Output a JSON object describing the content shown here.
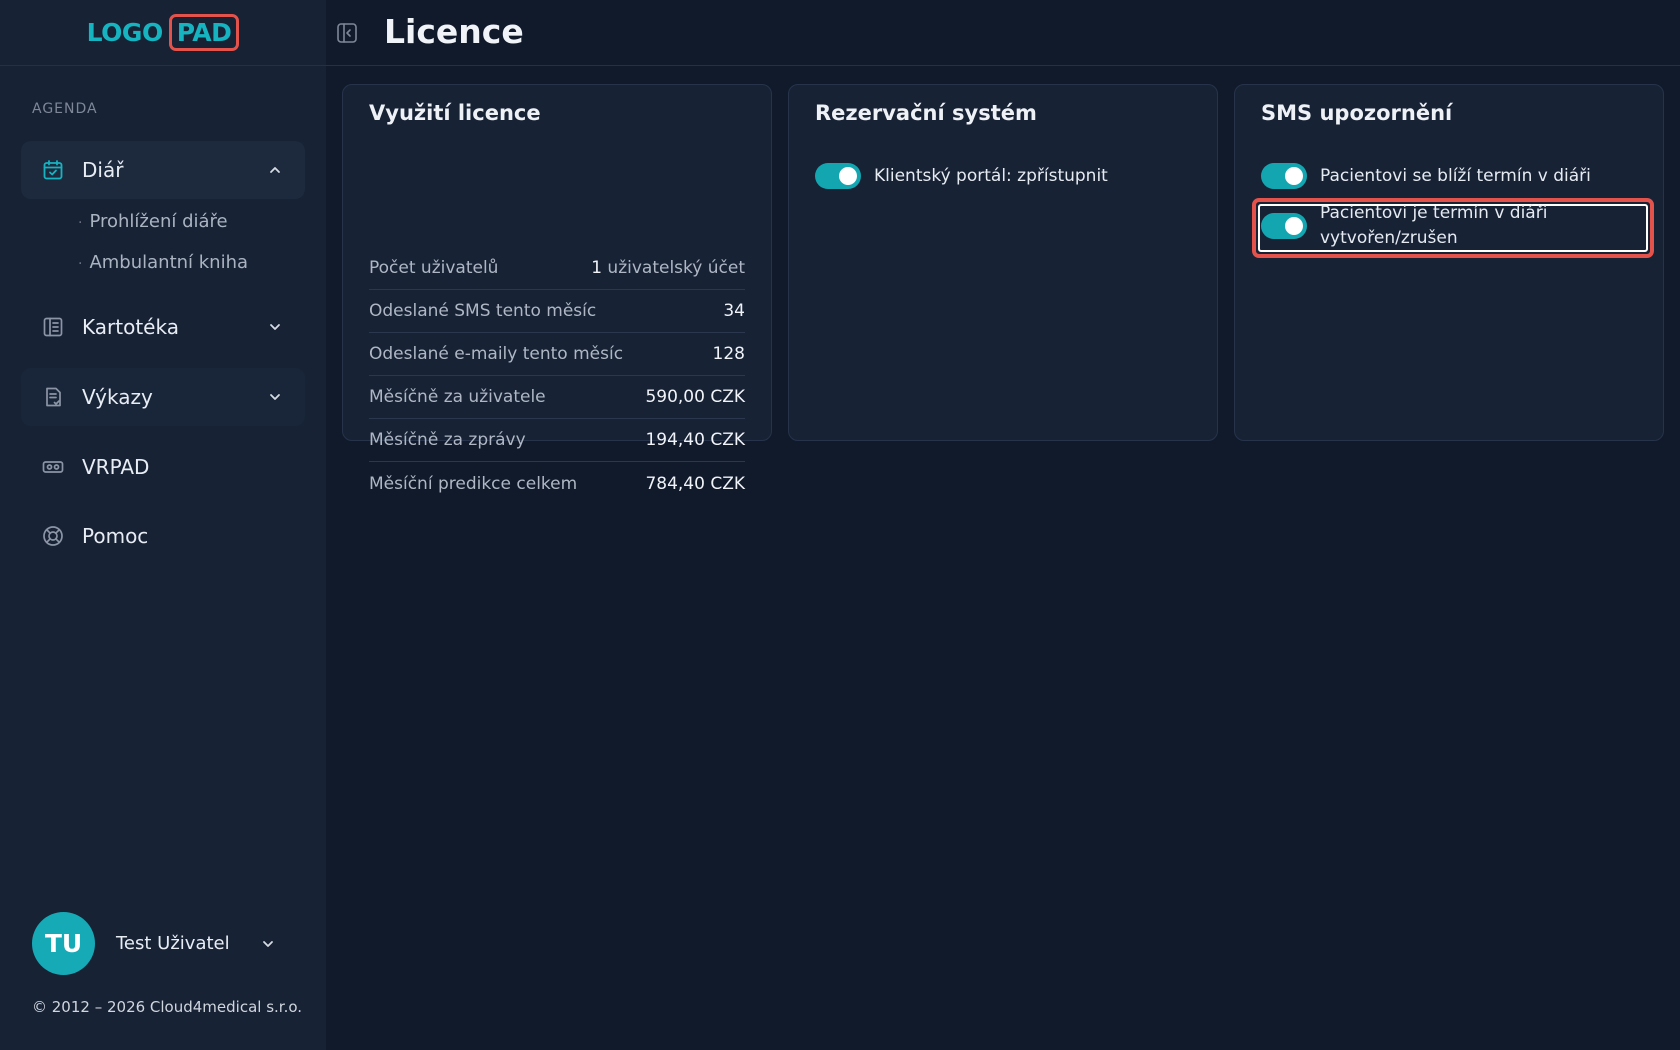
{
  "logo": {
    "left": "LOGO",
    "right": "PAD"
  },
  "sidebar": {
    "section_label": "AGENDA",
    "items": [
      {
        "label": "Diář",
        "icon": "calendar-check-icon"
      },
      {
        "label": "Kartotéka",
        "icon": "book-icon"
      },
      {
        "label": "Výkazy",
        "icon": "document-icon"
      },
      {
        "label": "VRPAD",
        "icon": "vr-headset-icon"
      },
      {
        "label": "Pomoc",
        "icon": "lifebuoy-icon"
      }
    ],
    "sub_items": [
      "Prohlížení diáře",
      "Ambulantní kniha"
    ]
  },
  "user": {
    "initials": "TU",
    "name": "Test Uživatel"
  },
  "copyright": "© 2012 – 2026 Cloud4medical s.r.o.",
  "header": {
    "title": "Licence"
  },
  "license_card": {
    "title": "Využití licence",
    "rows": [
      {
        "label": "Počet uživatelů",
        "value": "1",
        "unit": " uživatelský účet"
      },
      {
        "label": "Odeslané SMS tento měsíc",
        "value": "34",
        "unit": ""
      },
      {
        "label": "Odeslané e-maily tento měsíc",
        "value": "128",
        "unit": ""
      },
      {
        "label": "Měsíčně za uživatele",
        "value": "590,00 CZK",
        "unit": ""
      },
      {
        "label": "Měsíčně za zprávy",
        "value": "194,40 CZK",
        "unit": ""
      },
      {
        "label": "Měsíční predikce celkem",
        "value": "784,40 CZK",
        "unit": ""
      }
    ]
  },
  "reservation_card": {
    "title": "Rezervační systém",
    "toggles": [
      {
        "label": "Klientský portál: zpřístupnit",
        "on": true
      }
    ]
  },
  "sms_card": {
    "title": "SMS upozornění",
    "toggles": [
      {
        "label": "Pacientovi se blíží termín v diáři",
        "on": true
      },
      {
        "label_line1": "Pacientovi je termín v diáři",
        "label_line2": "vytvořen/zrušen",
        "on": true
      }
    ]
  },
  "colors": {
    "accent": "#13a6b1",
    "highlight": "#e4524c",
    "background": "#111a2b",
    "panel": "#172235"
  }
}
